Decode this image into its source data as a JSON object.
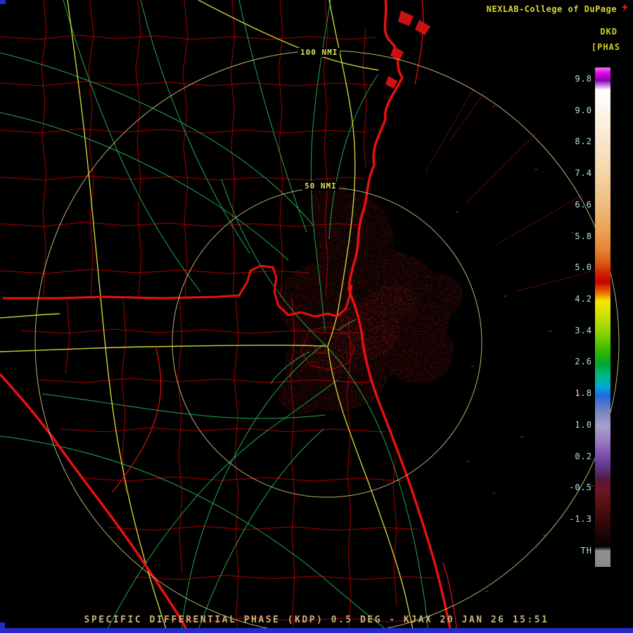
{
  "header": {
    "title": "NEXLAB-College of DuPage",
    "product_id": "DKD",
    "units": "[PHAS"
  },
  "colorbar": {
    "ticks": [
      "9.8",
      "9.0",
      "8.2",
      "7.4",
      "6.6",
      "5.8",
      "5.0",
      "4.2",
      "3.4",
      "2.6",
      "1.8",
      "1.0",
      "0.2",
      "-0.5",
      "-1.3",
      "TH"
    ]
  },
  "map": {
    "ring_labels": {
      "outer": "100 NMI",
      "inner": "50 NMI"
    },
    "radar_site": "KJAX"
  },
  "footer": {
    "caption": "SPECIFIC DIFFERENTIAL PHASE (KDP) 0.5 DEG - KJAX 20 JAN 26 15:51"
  },
  "colors": {
    "accent_blue": "#2a2ac8",
    "county_line": "#b40000",
    "state_coast": "#e81010",
    "interstate": "#cfcf3a",
    "secondary_road": "#1faa50",
    "range_ring": "#cfc87f",
    "header_text": "#d8d832",
    "tick_text": "#b8e0e0",
    "caption_text": "#c8b878",
    "echo_dark": "#5c0d0d",
    "echo_bright": "#8a1414"
  }
}
